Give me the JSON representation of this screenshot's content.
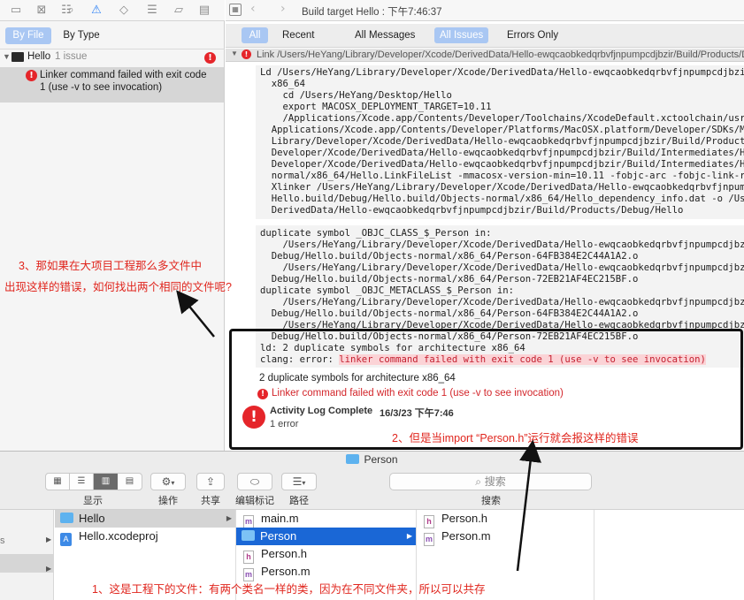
{
  "navigator": {
    "toolbar_icons": [
      "folder-icon",
      "source-control-icon",
      "hierarchy-icon",
      "search-icon",
      "issue-warning-icon",
      "test-diamond-icon",
      "debug-icon",
      "breakpoint-icon",
      "report-icon"
    ],
    "segment": {
      "by_file": "By File",
      "by_type": "By Type"
    },
    "group": {
      "name": "Hello",
      "count": "1 issue"
    },
    "issue": {
      "line1": "Linker command failed with exit code",
      "line2": "1 (use -v to see invocation)"
    }
  },
  "editor": {
    "jump_title": "Build target Hello : 下午7:46:37",
    "filters": {
      "all": "All",
      "recent": "Recent",
      "all_messages": "All Messages",
      "all_issues": "All Issues",
      "errors_only": "Errors Only"
    },
    "link_row": "Link /Users/HeYang/Library/Developer/Xcode/DerivedData/Hello-ewqcaobkedqrbvfjnpumpcdjbzir/Build/Products/Debug/Hello",
    "log_block_1": "Ld /Users/HeYang/Library/Developer/Xcode/DerivedData/Hello-ewqcaobkedqrbvfjnpumpcdjbzir/Build/Products/Debug/Hello normal\n  x86_64\n    cd /Users/HeYang/Desktop/Hello\n    export MACOSX_DEPLOYMENT_TARGET=10.11\n    /Applications/Xcode.app/Contents/Developer/Toolchains/XcodeDefault.xctoolchain/usr/bin/clang\n  Applications/Xcode.app/Contents/Developer/Platforms/MacOSX.platform/Developer/SDKs/MacOSX10.11.sdk\n  Library/Developer/Xcode/DerivedData/Hello-ewqcaobkedqrbvfjnpumpcdjbzir/Build/Products/Debug\n  Developer/Xcode/DerivedData/Hello-ewqcaobkedqrbvfjnpumpcdjbzir/Build/Intermediates/Hello.build\n  Developer/Xcode/DerivedData/Hello-ewqcaobkedqrbvfjnpumpcdjbzir/Build/Intermediates/Hello.build\n  normal/x86_64/Hello.LinkFileList -mmacosx-version-min=10.11 -fobjc-arc -fobjc-link-runtime\n  Xlinker /Users/HeYang/Library/Developer/Xcode/DerivedData/Hello-ewqcaobkedqrbvfjnpumpcdjbzir/Build/\n  Hello.build/Debug/Hello.build/Objects-normal/x86_64/Hello_dependency_info.dat -o /Users/HeYang/Library/\n  DerivedData/Hello-ewqcaobkedqrbvfjnpumpcdjbzir/Build/Products/Debug/Hello",
    "log_block_2": "duplicate symbol _OBJC_CLASS_$_Person in:\n    /Users/HeYang/Library/Developer/Xcode/DerivedData/Hello-ewqcaobkedqrbvfjnpumpcdjbzir/Build/Intermediates/Hello.build/\n  Debug/Hello.build/Objects-normal/x86_64/Person-64FB384E2C44A1A2.o\n    /Users/HeYang/Library/Developer/Xcode/DerivedData/Hello-ewqcaobkedqrbvfjnpumpcdjbzir/Build/Intermediates/Hello.build/\n  Debug/Hello.build/Objects-normal/x86_64/Person-72EB21AF4EC215BF.o\nduplicate symbol _OBJC_METACLASS_$_Person in:\n    /Users/HeYang/Library/Developer/Xcode/DerivedData/Hello-ewqcaobkedqrbvfjnpumpcdjbzir/Build/Intermediates/Hello.build/\n  Debug/Hello.build/Objects-normal/x86_64/Person-64FB384E2C44A1A2.o\n    /Users/HeYang/Library/Developer/Xcode/DerivedData/Hello-ewqcaobkedqrbvfjnpumpcdjbzir/Build/Intermediates/Hello.build/\n  Debug/Hello.build/Objects-normal/x86_64/Person-72EB21AF4EC215BF.o\nld: 2 duplicate symbols for architecture x86_64",
    "clang_prefix": "clang: error: ",
    "clang_error": "linker command failed with exit code 1 (use -v to see invocation)",
    "summary_line": "2 duplicate symbols for architecture x86_64",
    "error_line": "Linker command failed with exit code 1 (use -v to see invocation)",
    "activity_title": "Activity Log Complete",
    "activity_time": "16/3/23 下午7:46",
    "activity_count": "1 error"
  },
  "annotations": {
    "note3_line1": "3、那如果在大项目工程那么多文件中",
    "note3_line2": "出现这样的错误，如何找出两个相同的文件呢?",
    "note2": "2、但是当import “Person.h”运行就会报这样的错误",
    "note1": "1、这是工程下的文件：有两个类名一样的类，因为在不同文件夹，所以可以共存",
    "color": "#e0261e"
  },
  "finder": {
    "title": "Person",
    "toolbar": {
      "view_label": "显示",
      "action_label": "操作",
      "share_label": "共享",
      "tags_label": "编辑标记",
      "path_label": "路径",
      "search_placeholder": "搜索",
      "search_label": "搜索"
    },
    "col1": [
      "Hello",
      "Hello.xcodeproj"
    ],
    "col2": [
      "main.m",
      "Person",
      "Person.h",
      "Person.m"
    ],
    "col3": [
      "Person.h",
      "Person.m"
    ],
    "selected_color": "#1a67d6"
  }
}
